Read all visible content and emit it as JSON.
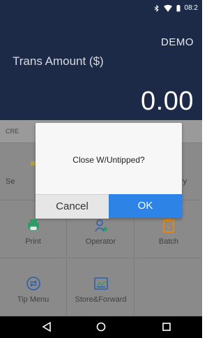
{
  "status_bar": {
    "time": "08:2",
    "icons": [
      "bluetooth-icon",
      "wifi-icon",
      "battery-icon"
    ]
  },
  "header": {
    "mode": "DEMO",
    "amount_label": "Trans Amount ($)",
    "amount_value": "0.00"
  },
  "cred_bar": {
    "text": "CRE"
  },
  "grid": {
    "row1": {
      "left_partial": "Se",
      "right_partial": "ry"
    },
    "row2": [
      {
        "label": "Print",
        "icon": "printer-icon"
      },
      {
        "label": "Operator",
        "icon": "operator-icon"
      },
      {
        "label": "Batch",
        "icon": "batch-icon"
      }
    ],
    "row3": [
      {
        "label": "Tip Menu",
        "icon": "tip-menu-icon"
      },
      {
        "label": "Store&Forward",
        "icon": "store-forward-icon"
      }
    ]
  },
  "dialog": {
    "message": "Close W/Untipped?",
    "cancel": "Cancel",
    "ok": "OK"
  },
  "nav": {
    "icons": [
      "back-icon",
      "home-icon",
      "recents-icon"
    ]
  },
  "colors": {
    "header_bg": "#1c2a47",
    "dialog_ok": "#2d84e6",
    "icon_green": "#2f9b66",
    "icon_blue": "#2b5fae",
    "icon_orange": "#e8850c"
  }
}
